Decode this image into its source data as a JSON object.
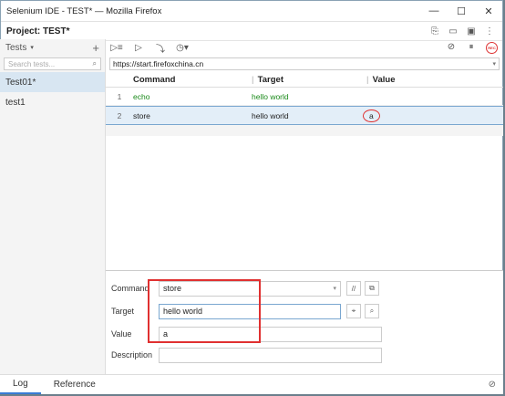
{
  "window": {
    "title": "Selenium IDE - TEST* — Mozilla Firefox"
  },
  "project": {
    "label": "Project:",
    "name": "TEST*"
  },
  "sidebar": {
    "header": "Tests",
    "search_placeholder": "Search tests...",
    "tests": [
      {
        "name": "Test01*",
        "selected": true
      },
      {
        "name": "test1",
        "selected": false
      }
    ]
  },
  "url_bar": {
    "value": "https://start.firefoxchina.cn"
  },
  "table": {
    "headers": [
      "Command",
      "Target",
      "Value"
    ],
    "rows": [
      {
        "num": "1",
        "command": "echo",
        "target": "hello world",
        "value": ""
      },
      {
        "num": "2",
        "command": "store",
        "target": "hello world",
        "value": "a"
      }
    ]
  },
  "editor": {
    "command_label": "Command",
    "command_value": "store",
    "target_label": "Target",
    "target_value": "hello world",
    "value_label": "Value",
    "value_value": "a",
    "description_label": "Description",
    "description_value": ""
  },
  "bottom_tabs": [
    "Log",
    "Reference"
  ],
  "colors": {
    "accent": "#3a7bd5",
    "annotation": "#e03030",
    "green": "#1a8a1a"
  }
}
